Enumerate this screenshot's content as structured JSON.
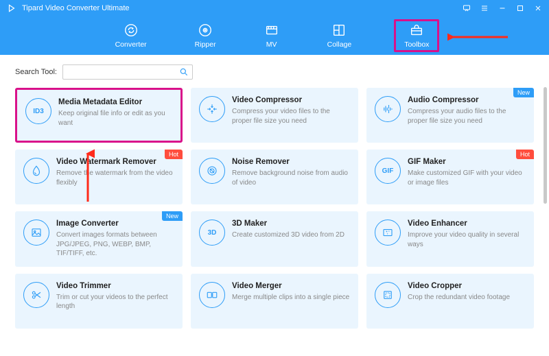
{
  "app": {
    "title": "Tipard Video Converter Ultimate"
  },
  "tabs": [
    {
      "id": "converter",
      "label": "Converter"
    },
    {
      "id": "ripper",
      "label": "Ripper"
    },
    {
      "id": "mv",
      "label": "MV"
    },
    {
      "id": "collage",
      "label": "Collage"
    },
    {
      "id": "toolbox",
      "label": "Toolbox"
    }
  ],
  "search": {
    "label": "Search Tool:",
    "placeholder": ""
  },
  "tools": [
    {
      "icon": "ID3",
      "title": "Media Metadata Editor",
      "desc": "Keep original file info or edit as you want",
      "badge": null,
      "highlight": true
    },
    {
      "icon": "compress",
      "title": "Video Compressor",
      "desc": "Compress your video files to the proper file size you need",
      "badge": null
    },
    {
      "icon": "audio-compress",
      "title": "Audio Compressor",
      "desc": "Compress your audio files to the proper file size you need",
      "badge": "New"
    },
    {
      "icon": "watermark",
      "title": "Video Watermark Remover",
      "desc": "Remove the watermark from the video flexibly",
      "badge": "Hot"
    },
    {
      "icon": "noise",
      "title": "Noise Remover",
      "desc": "Remove background noise from audio of video",
      "badge": null
    },
    {
      "icon": "GIF",
      "title": "GIF Maker",
      "desc": "Make customized GIF with your video or image files",
      "badge": "Hot"
    },
    {
      "icon": "image",
      "title": "Image Converter",
      "desc": "Convert images formats between JPG/JPEG, PNG, WEBP, BMP, TIF/TIFF, etc.",
      "badge": "New"
    },
    {
      "icon": "3D",
      "title": "3D Maker",
      "desc": "Create customized 3D video from 2D",
      "badge": null
    },
    {
      "icon": "enhance",
      "title": "Video Enhancer",
      "desc": "Improve your video quality in several ways",
      "badge": null
    },
    {
      "icon": "trim",
      "title": "Video Trimmer",
      "desc": "Trim or cut your videos to the perfect length",
      "badge": null
    },
    {
      "icon": "merge",
      "title": "Video Merger",
      "desc": "Merge multiple clips into a single piece",
      "badge": null
    },
    {
      "icon": "crop",
      "title": "Video Cropper",
      "desc": "Crop the redundant video footage",
      "badge": null
    }
  ]
}
